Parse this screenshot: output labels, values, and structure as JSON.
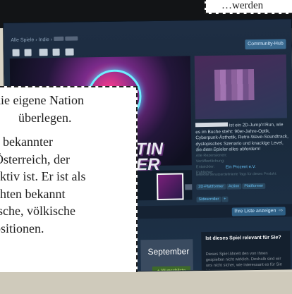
{
  "overlay_top": {
    "text": "…werden"
  },
  "steam": {
    "breadcrumb": "Alle Spiele › Indie › ",
    "community_button": "Community-Hub",
    "media_words": [
      "RTIN",
      "NER"
    ],
    "description": "ist ein 2D-Jump'n'Run, wie es im Buche steht: 90er-Jahre-Optik, Cyberpunk-Ästhetik, Retro-Wave-Soundtrack, dystopisches Szenario und knackige Level, die dem Spieler alles abfordern!",
    "info_lines": [
      "Neue Rezensionen:",
      "Alle Rezensionen:",
      "Veröffentlichung:",
      "Entwickler:",
      "Publisher:"
    ],
    "added_by": "Ein Prozent e.V.",
    "tags_intro": "Beliebte benutzerdefinierte Tags für dieses Produkt:",
    "tags": [
      "2D-Plattformer",
      "Action",
      "Plattformer",
      "Sidescroller",
      "+"
    ],
    "list_button": "Ihre Liste anzeigen",
    "list_arrow": "⇨",
    "release_month": "September",
    "wishlist_button": "+ Wunschliste",
    "relevance_title": "Ist dieses Spiel relevant für Sie?",
    "relevance_text": "Dieses Spiel ähnelt den von Ihnen gespielten nicht wirklich. Deshalb sind wir uns nicht sicher, wie interessant es für Sie ist."
  },
  "callout": {
    "line1": "die eigene Nation",
    "line2": "überlegen.",
    "lines": [
      "bekannter",
      "Österreich, der",
      "aktiv ist. Er ist als",
      "chten bekannt",
      "ische, völkische",
      "ositionen."
    ]
  }
}
